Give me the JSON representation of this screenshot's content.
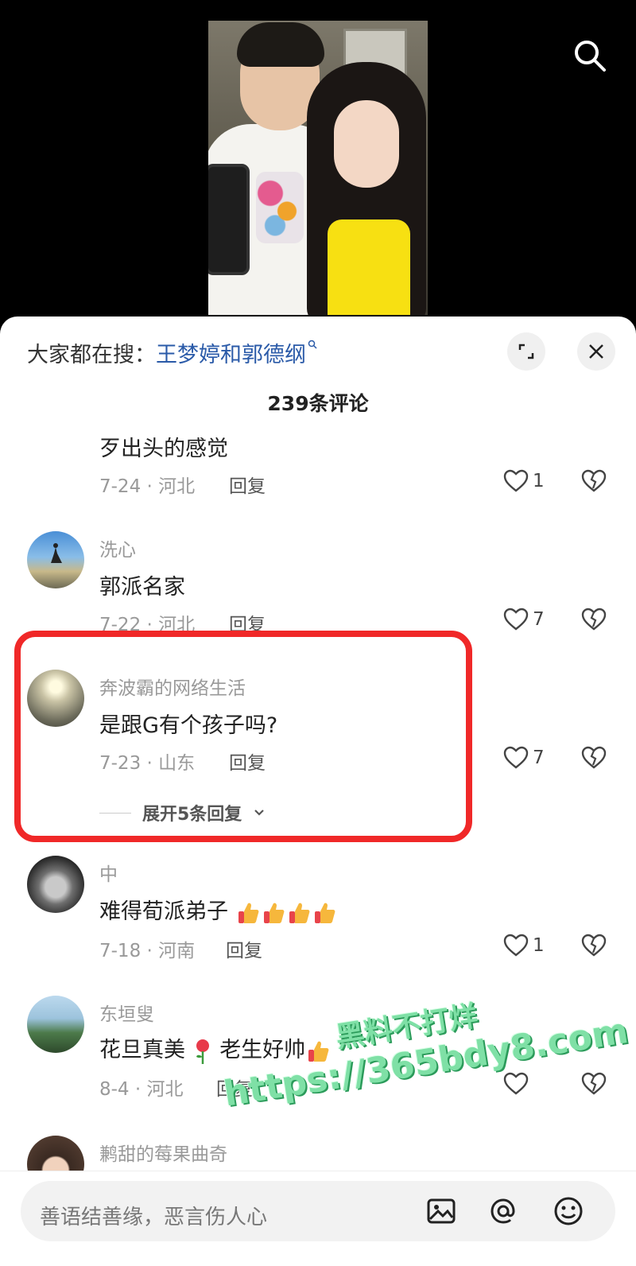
{
  "header": {
    "hot_search_prefix": "大家都在搜：",
    "hot_search_keyword": "王梦婷和郭德纲"
  },
  "comment_count": "239条评论",
  "comments": [
    {
      "username": "",
      "content": "歹出头的感觉",
      "date_location": "7-24 · 河北",
      "reply_label": "回复",
      "likes": "1"
    },
    {
      "username": "洗心",
      "content": "郭派名家",
      "date_location": "7-22 · 河北",
      "reply_label": "回复",
      "likes": "7"
    },
    {
      "username": "奔波霸的网络生活",
      "content": "是跟G有个孩子吗?",
      "date_location": "7-23 · 山东",
      "reply_label": "回复",
      "likes": "7",
      "expand_replies": "展开5条回复"
    },
    {
      "username": "中",
      "content": "难得荀派弟子",
      "date_location": "7-18 · 河南",
      "reply_label": "回复",
      "likes": "1"
    },
    {
      "username": "东垣叟",
      "content_part1": "花旦真美",
      "content_part2": "老生好帅",
      "date_location": "8-4 · 河北",
      "reply_label": "回复",
      "likes": ""
    },
    {
      "username": "鹣甜的莓果曲奇"
    }
  ],
  "watermark": {
    "line1": "黑料不打烊",
    "line2": "https://365bdy8.com"
  },
  "input": {
    "placeholder": "善语结善缘，恶言伤人心"
  },
  "icons": {
    "search": "search-icon",
    "expand": "expand-icon",
    "close": "close-icon",
    "like": "heart-icon",
    "dislike": "broken-heart-icon",
    "image": "image-icon",
    "mention": "at-icon",
    "emoji": "emoji-icon"
  },
  "colors": {
    "accent_link": "#2a5aa8",
    "highlight_border": "#f02828",
    "watermark": "#7fe0a6"
  }
}
